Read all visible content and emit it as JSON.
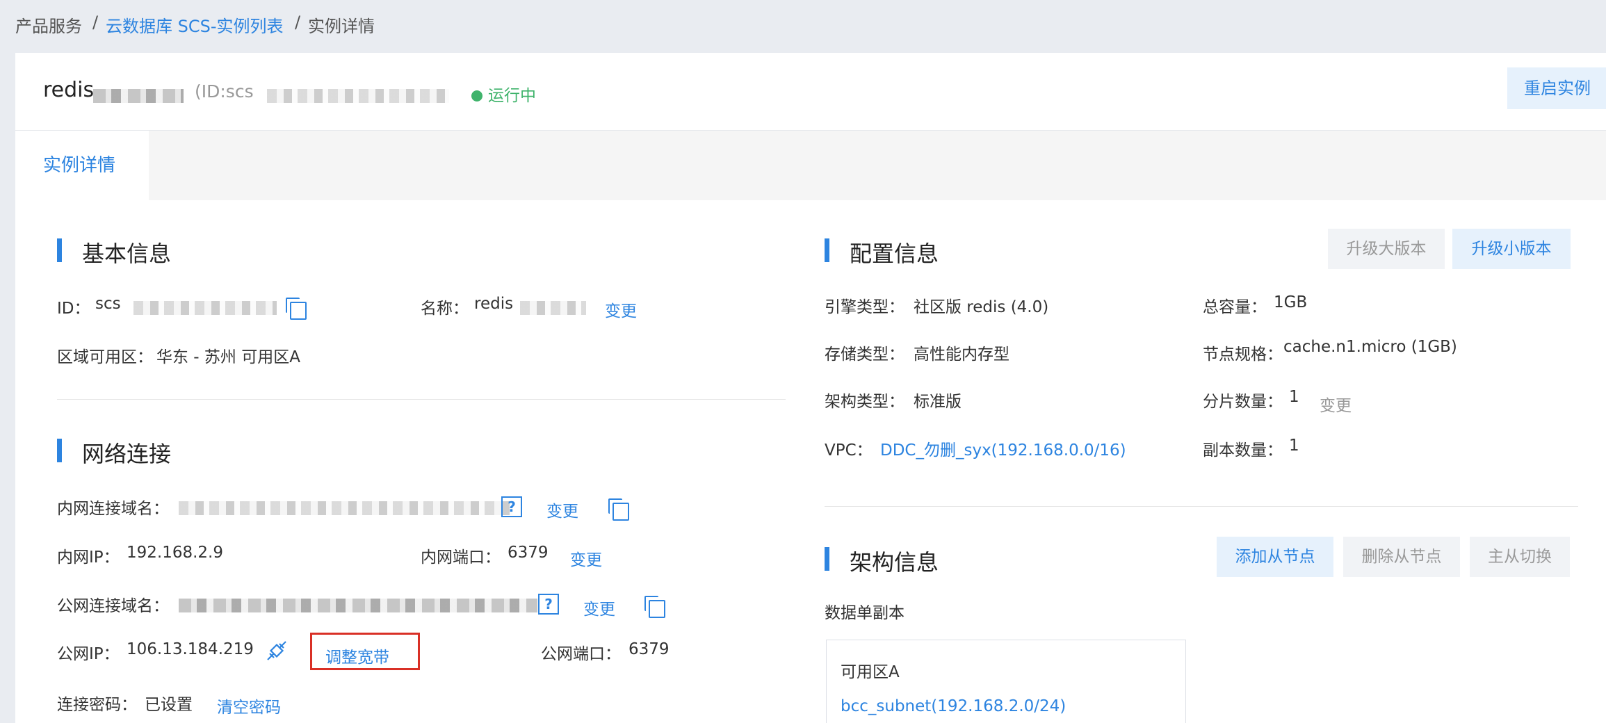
{
  "breadcrumb": {
    "items": [
      "产品服务",
      "云数据库 SCS-实例列表",
      "实例详情"
    ],
    "separator": "/"
  },
  "header": {
    "instance_name": "redis",
    "id_prefix": "(ID:scs",
    "status": "运行中",
    "restart_button": "重启实例"
  },
  "tabs": [
    {
      "label": "实例详情",
      "active": true
    }
  ],
  "basic_info": {
    "title": "基本信息",
    "id_label": "ID：",
    "id_value": "scs",
    "name_label": "名称：",
    "name_value": "redis",
    "name_change": "变更",
    "zone_label": "区域可用区：",
    "zone_value": "华东 - 苏州 可用区A"
  },
  "network": {
    "title": "网络连接",
    "internal_domain_label": "内网连接域名：",
    "internal_domain_help": "?",
    "internal_domain_change": "变更",
    "internal_ip_label": "内网IP：",
    "internal_ip_value": "192.168.2.9",
    "internal_port_label": "内网端口：",
    "internal_port_value": "6379",
    "internal_port_change": "变更",
    "public_domain_label": "公网连接域名：",
    "public_domain_help": "?",
    "public_domain_change": "变更",
    "public_ip_label": "公网IP：",
    "public_ip_value": "106.13.184.219",
    "adjust_bandwidth": "调整宽带",
    "public_port_label": "公网端口：",
    "public_port_value": "6379",
    "password_label": "连接密码：",
    "password_value": "已设置",
    "clear_password": "清空密码"
  },
  "config": {
    "title": "配置信息",
    "upgrade_major": "升级大版本",
    "upgrade_minor": "升级小版本",
    "engine_label": "引擎类型：",
    "engine_value": "社区版 redis (4.0)",
    "capacity_label": "总容量：",
    "capacity_value": "1GB",
    "storage_label": "存储类型：",
    "storage_value": "高性能内存型",
    "node_spec_label": "节点规格：",
    "node_spec_value": "cache.n1.micro (1GB)",
    "arch_label": "架构类型：",
    "arch_value": "标准版",
    "shard_label": "分片数量：",
    "shard_value": "1",
    "shard_change": "变更",
    "vpc_label": "VPC：",
    "vpc_value": "DDC_勿删_syx(192.168.0.0/16)",
    "replica_label": "副本数量：",
    "replica_value": "1"
  },
  "architecture": {
    "title": "架构信息",
    "add_replica": "添加从节点",
    "delete_replica": "删除从节点",
    "switch_master": "主从切换",
    "mode": "数据单副本",
    "zone": "可用区A",
    "subnet": "bcc_subnet(192.168.2.0/24)"
  },
  "colors": {
    "accent": "#2d84e0",
    "status_running": "#3fb36b",
    "highlight_box": "#d93026"
  }
}
